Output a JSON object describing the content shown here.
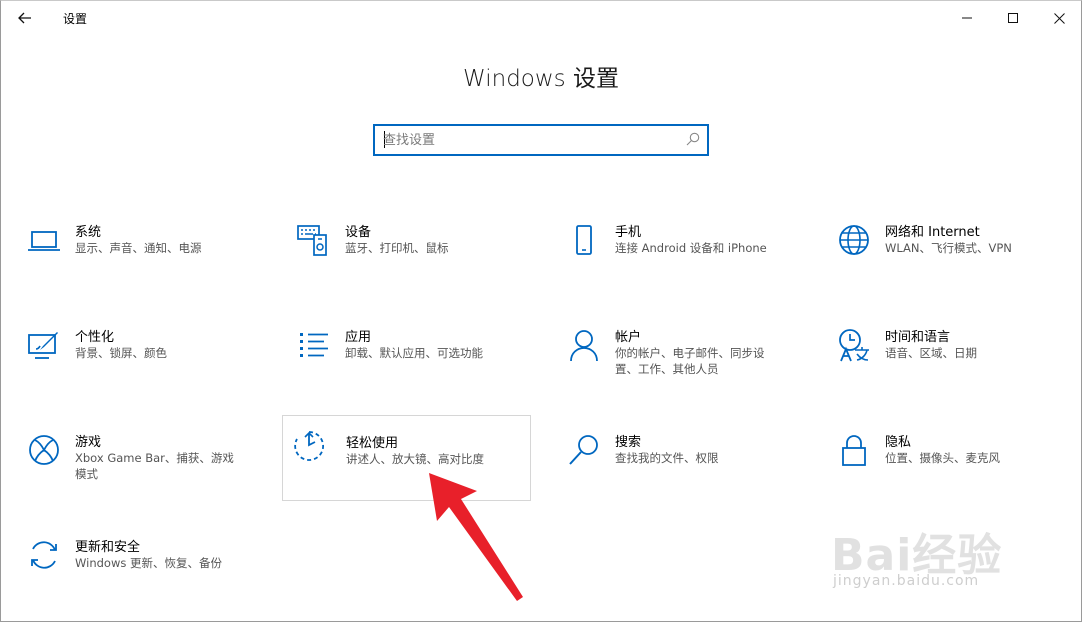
{
  "window": {
    "title": "设置",
    "controls": {
      "minimize": "minimize-icon",
      "maximize": "maximize-icon",
      "close": "close-icon"
    }
  },
  "heading": "Windows 设置",
  "search": {
    "placeholder": "查找设置",
    "value": ""
  },
  "tiles": [
    {
      "id": "system",
      "icon": "laptop-icon",
      "title": "系统",
      "desc": "显示、声音、通知、电源"
    },
    {
      "id": "devices",
      "icon": "devices-icon",
      "title": "设备",
      "desc": "蓝牙、打印机、鼠标"
    },
    {
      "id": "phone",
      "icon": "phone-icon",
      "title": "手机",
      "desc": "连接 Android 设备和 iPhone"
    },
    {
      "id": "network",
      "icon": "globe-icon",
      "title": "网络和 Internet",
      "desc": "WLAN、飞行模式、VPN"
    },
    {
      "id": "personalization",
      "icon": "personalization-icon",
      "title": "个性化",
      "desc": "背景、锁屏、颜色"
    },
    {
      "id": "apps",
      "icon": "apps-list-icon",
      "title": "应用",
      "desc": "卸载、默认应用、可选功能"
    },
    {
      "id": "accounts",
      "icon": "person-icon",
      "title": "帐户",
      "desc": "你的帐户、电子邮件、同步设置、工作、其他人员"
    },
    {
      "id": "time-language",
      "icon": "time-language-icon",
      "title": "时间和语言",
      "desc": "语音、区域、日期"
    },
    {
      "id": "gaming",
      "icon": "xbox-icon",
      "title": "游戏",
      "desc": "Xbox Game Bar、捕获、游戏模式"
    },
    {
      "id": "ease-of-access",
      "icon": "ease-of-access-icon",
      "title": "轻松使用",
      "desc": "讲述人、放大镜、高对比度"
    },
    {
      "id": "search",
      "icon": "magnifier-icon",
      "title": "搜索",
      "desc": "查找我的文件、权限"
    },
    {
      "id": "privacy",
      "icon": "lock-icon",
      "title": "隐私",
      "desc": "位置、摄像头、麦克风"
    },
    {
      "id": "update-security",
      "icon": "sync-icon",
      "title": "更新和安全",
      "desc": "Windows 更新、恢复、备份"
    }
  ],
  "colors": {
    "accent": "#0067c0",
    "annotation": "#e8202a"
  },
  "watermark": {
    "brand": "Bai经验",
    "url": "jingyan.baidu.com"
  }
}
